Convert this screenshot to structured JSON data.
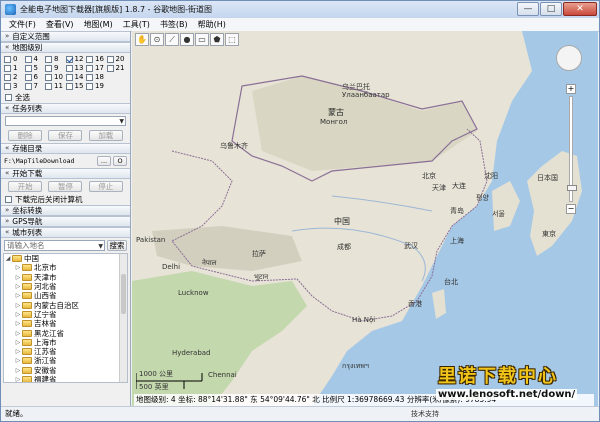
{
  "window": {
    "title": "全能电子地图下载器[旗舰版] 1.8.7 - 谷歌地图-街道图",
    "minimize": "—",
    "maximize": "□",
    "close": "✕"
  },
  "menu": [
    "文件(F)",
    "查看(V)",
    "地图(M)",
    "工具(T)",
    "书签(B)",
    "帮助(H)"
  ],
  "sections": {
    "custom_range": "自定义范围",
    "map_level": "地图级别",
    "task_list": "任务列表",
    "storage_dir": "存储目录",
    "start_download": "开始下载",
    "coord_convert": "坐标转换",
    "gps_nav": "GPS导航",
    "city_list": "城市列表"
  },
  "levels": [
    {
      "n": "0",
      "checked": false
    },
    {
      "n": "4",
      "checked": false
    },
    {
      "n": "8",
      "checked": false
    },
    {
      "n": "12",
      "checked": true
    },
    {
      "n": "16",
      "checked": false
    },
    {
      "n": "20",
      "checked": false
    },
    {
      "n": "1",
      "checked": false
    },
    {
      "n": "5",
      "checked": false
    },
    {
      "n": "9",
      "checked": false
    },
    {
      "n": "13",
      "checked": false
    },
    {
      "n": "17",
      "checked": false
    },
    {
      "n": "21",
      "checked": false
    },
    {
      "n": "2",
      "checked": false
    },
    {
      "n": "6",
      "checked": false
    },
    {
      "n": "10",
      "checked": false
    },
    {
      "n": "14",
      "checked": false
    },
    {
      "n": "18",
      "checked": false
    },
    {
      "n": "",
      "checked": false
    },
    {
      "n": "3",
      "checked": false
    },
    {
      "n": "7",
      "checked": false
    },
    {
      "n": "11",
      "checked": false
    },
    {
      "n": "15",
      "checked": false
    },
    {
      "n": "19",
      "checked": false
    },
    {
      "n": "",
      "checked": false
    }
  ],
  "select_all": "全选",
  "task_buttons": {
    "delete": "删除",
    "save": "保存",
    "load": "加载"
  },
  "storage": {
    "path": "F:\\MapTileDownload",
    "browse": "...",
    "open": "O"
  },
  "download_buttons": {
    "start": "开始",
    "pause": "暂停",
    "stop": "停止"
  },
  "shutdown_label": "下载完后关闭计算机",
  "city_search": {
    "placeholder": "请输入地名",
    "button": "搜索"
  },
  "city_tree": {
    "root": "中国",
    "items": [
      "北京市",
      "天津市",
      "河北省",
      "山西省",
      "内蒙古自治区",
      "辽宁省",
      "吉林省",
      "黑龙江省",
      "上海市",
      "江苏省",
      "浙江省",
      "安徽省",
      "福建省"
    ]
  },
  "map_labels": {
    "mongolia_cn": "蒙古",
    "mongolia_mn": "Монгол",
    "ulaanbaatar": "乌兰巴托",
    "ulaanbaatar_mn": "Улаанбаатар",
    "china": "中国",
    "japan": "日本国",
    "beijing": "北京",
    "tianjin": "天津",
    "shenyang": "沈阳",
    "dalian": "大连",
    "qingdao": "青岛",
    "chengdu": "成都",
    "wuhan": "武汉",
    "shanghai": "上海",
    "taipei": "台北",
    "hongkong": "香港",
    "hanoi": "Hà Nội",
    "lhasa": "拉萨",
    "nepal": "नेपाल",
    "bhutan": "भूटान",
    "delhi": "Delhi",
    "pakistan": "Pakistan",
    "lucknow": "Lucknow",
    "urumqi": "乌鲁木齐",
    "hyderabad": "Hyderabad",
    "chennai": "Chennai",
    "bangkok": "กรุงเทพฯ",
    "tokyo": "東京",
    "seoul": "서울",
    "pyongyang": "평양"
  },
  "scale": {
    "km": "1000 公里",
    "mi": "500 英里"
  },
  "coord_text": "地图级别: 4  坐标: 88°14'31.88\" 东  54°09'44.76\" 北  比例尺 1:36978669.43 分辨率(米/像素): 9783.94",
  "watermark": {
    "title": "里诺下载中心",
    "url": "www.lenosoft.net/down/"
  },
  "status": {
    "left": "就绪。",
    "right": "技术支持"
  },
  "colors": {
    "land": "#e7e3d6",
    "water": "#a4c8e6",
    "green": "#bcd5a4",
    "border": "#8a6f96"
  }
}
